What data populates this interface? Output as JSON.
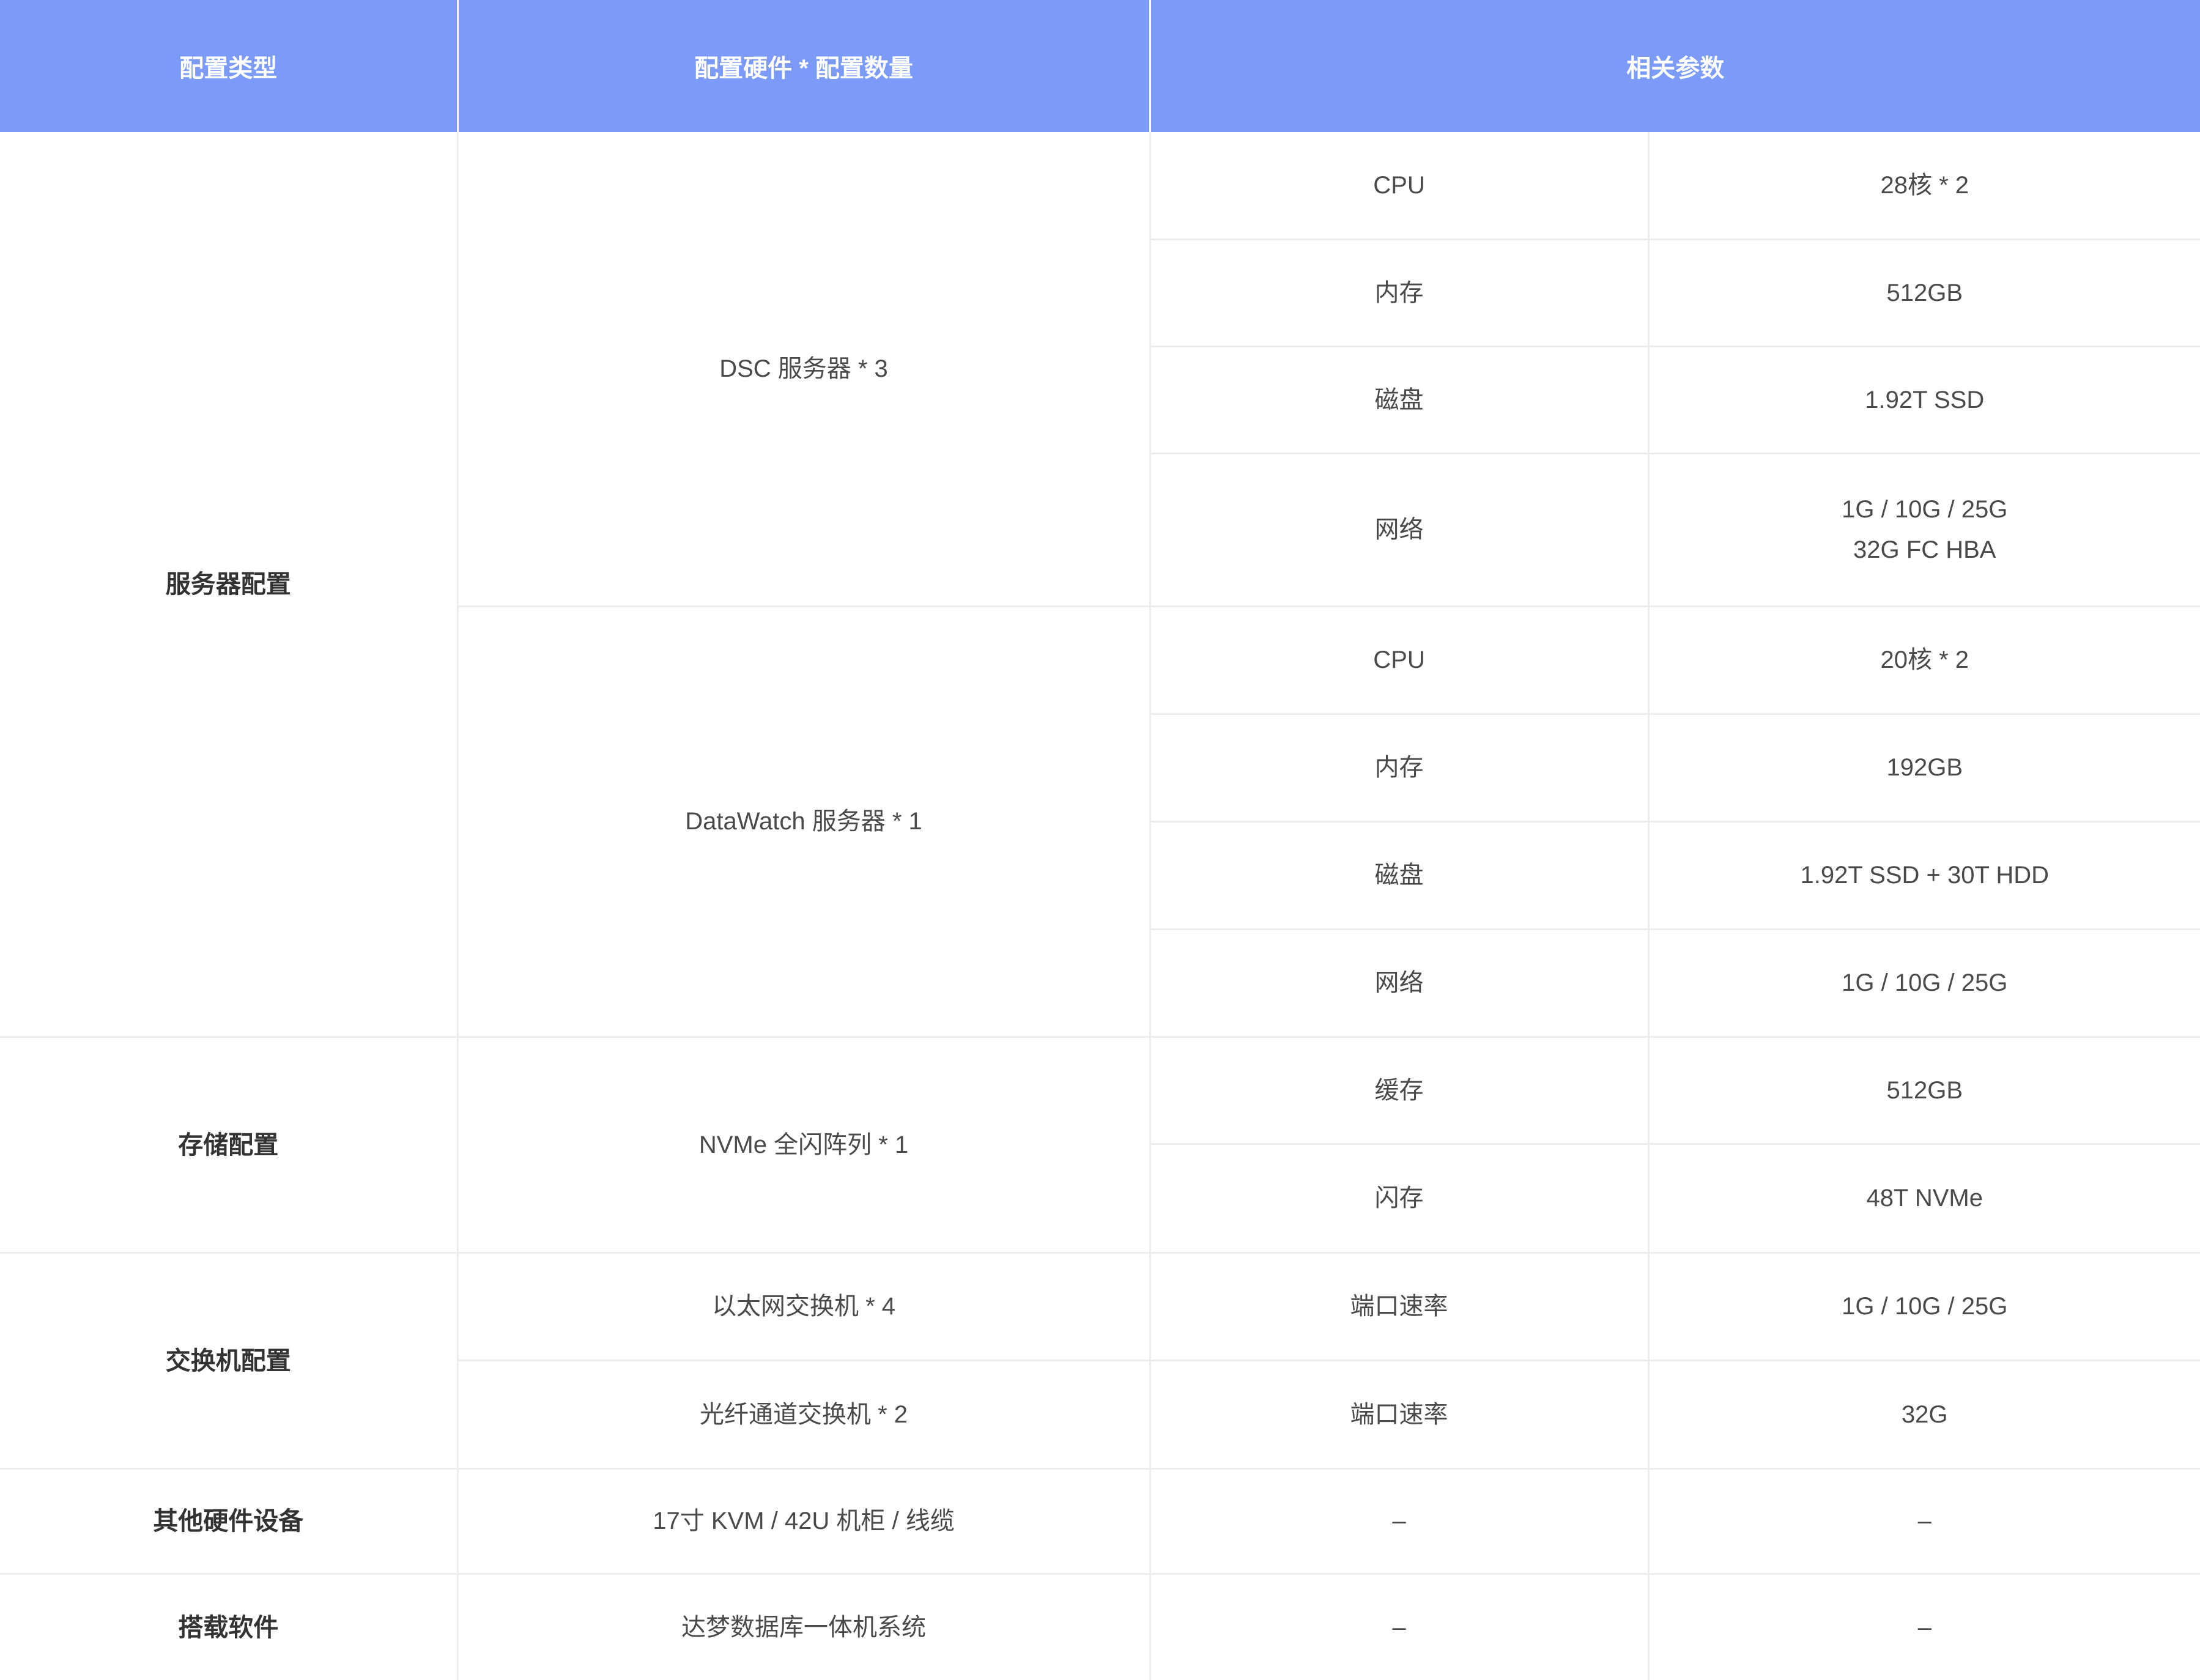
{
  "table": {
    "headers": {
      "config_type": "配置类型",
      "hardware_qty": "配置硬件 * 配置数量",
      "params": "相关参数"
    },
    "server_config": {
      "type": "服务器配置",
      "dsc": {
        "hardware": "DSC 服务器 * 3",
        "rows": [
          {
            "name": "CPU",
            "value": "28核 * 2"
          },
          {
            "name": "内存",
            "value": "512GB"
          },
          {
            "name": "磁盘",
            "value": "1.92T SSD"
          },
          {
            "name": "网络",
            "value_line1": "1G / 10G / 25G",
            "value_line2": "32G FC HBA"
          }
        ]
      },
      "datawatch": {
        "hardware": "DataWatch 服务器 * 1",
        "rows": [
          {
            "name": "CPU",
            "value": "20核 * 2"
          },
          {
            "name": "内存",
            "value": "192GB"
          },
          {
            "name": "磁盘",
            "value": "1.92T SSD + 30T HDD"
          },
          {
            "name": "网络",
            "value": "1G / 10G / 25G"
          }
        ]
      }
    },
    "storage_config": {
      "type": "存储配置",
      "hardware": "NVMe 全闪阵列 * 1",
      "rows": [
        {
          "name": "缓存",
          "value": "512GB"
        },
        {
          "name": "闪存",
          "value": "48T NVMe"
        }
      ]
    },
    "switch_config": {
      "type": "交换机配置",
      "rows": [
        {
          "hardware": "以太网交换机 * 4",
          "name": "端口速率",
          "value": "1G / 10G / 25G"
        },
        {
          "hardware": "光纤通道交换机 * 2",
          "name": "端口速率",
          "value": "32G"
        }
      ]
    },
    "other_hardware": {
      "type": "其他硬件设备",
      "hardware": "17寸 KVM / 42U 机柜 / 线缆",
      "name": "–",
      "value": "–"
    },
    "software": {
      "type": "搭载软件",
      "hardware": "达梦数据库一体机系统",
      "name": "–",
      "value": "–"
    }
  }
}
